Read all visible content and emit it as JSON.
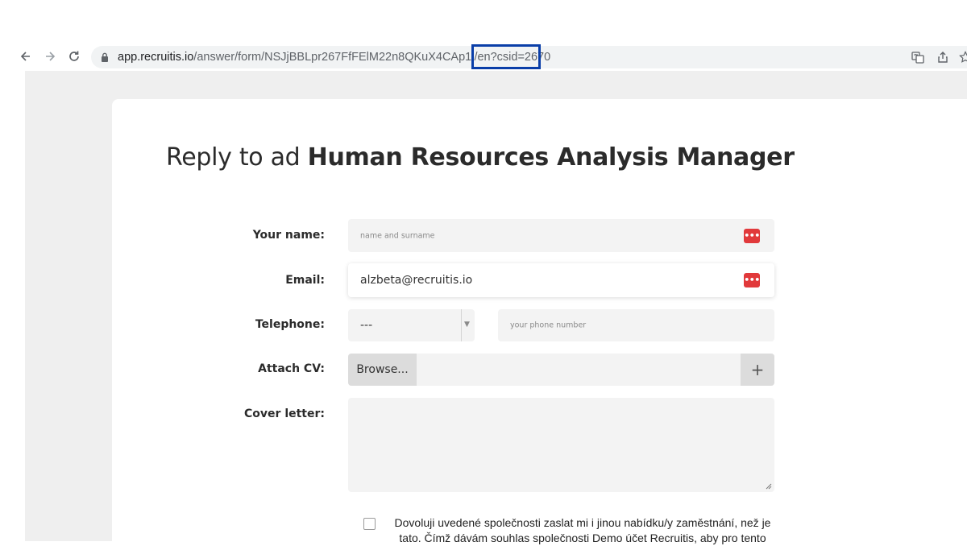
{
  "browser": {
    "url_host": "app.recruitis.io",
    "url_path": "/answer/form/NSJjBBLpr267FfFElM22n8QKuX4CAp1i/en?csid=2670",
    "icons": {
      "back": "back-arrow-icon",
      "forward": "forward-arrow-icon",
      "reload": "reload-icon",
      "lock": "lock-icon",
      "translate": "translate-icon",
      "share": "share-icon",
      "bookmark": "bookmark-star-icon"
    },
    "highlight_color": "#0a3ea8"
  },
  "form": {
    "title_prefix": "Reply to ad ",
    "title_job": "Human Resources Analysis Manager",
    "name": {
      "label": "Your name:",
      "placeholder": "name and surname"
    },
    "email": {
      "label": "Email:",
      "value": "alzbeta@recruitis.io"
    },
    "telephone": {
      "label": "Telephone:",
      "prefix_value": "---",
      "placeholder": "your phone number"
    },
    "cv": {
      "label": "Attach CV:",
      "browse_label": "Browse...",
      "add_label": "+"
    },
    "cover_letter": {
      "label": "Cover letter:"
    },
    "consent": {
      "text": "Dovoluji uvedené společnosti zaslat mi i jinou nabídku/y zaměstnání, než je tato. Čímž dávám souhlas společnosti Demo účet Recruitis, aby pro tento"
    },
    "password_manager_icon": "password-manager-icon",
    "accent_color": "#e1393b"
  }
}
